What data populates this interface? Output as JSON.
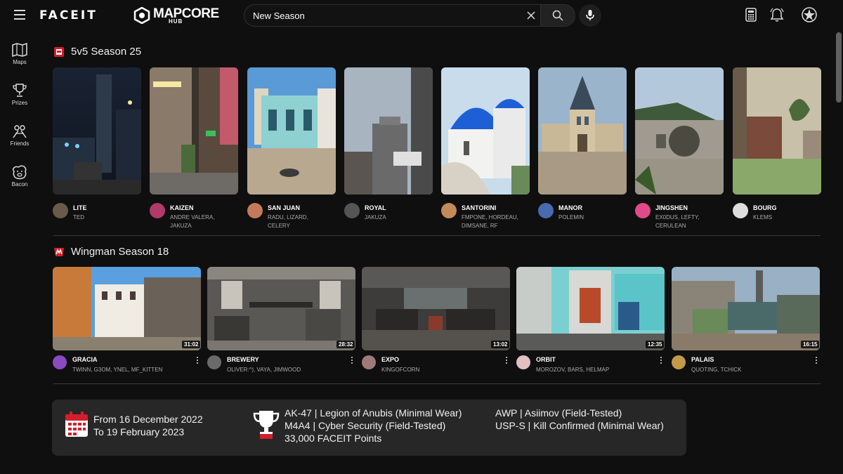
{
  "header": {
    "brand": "FACEIT",
    "partner_brand": "MAPCORE",
    "partner_sub": "HUB",
    "search_value": "New Season"
  },
  "sidebar": {
    "items": [
      {
        "label": "Maps",
        "icon": "map-icon"
      },
      {
        "label": "Prizes",
        "icon": "trophy-icon"
      },
      {
        "label": "Friends",
        "icon": "friends-icon"
      },
      {
        "label": "Bacon",
        "icon": "bacon-icon"
      }
    ]
  },
  "section1": {
    "title": "5v5 Season 25",
    "cards": [
      {
        "name": "LITE",
        "authors": [
          "TED"
        ],
        "avatar_color": "#6a5a4a"
      },
      {
        "name": "KAIZEN",
        "authors": [
          "ANDRE VALERA,",
          "JAKUZA"
        ],
        "avatar_color": "#b03a6a"
      },
      {
        "name": "SAN JUAN",
        "authors": [
          "RADU, LIZARD,",
          "CELERY"
        ],
        "avatar_color": "#c47a5a"
      },
      {
        "name": "ROYAL",
        "authors": [
          "JAKUZA"
        ],
        "avatar_color": "#555555"
      },
      {
        "name": "SANTORINI",
        "authors": [
          "FMPONE, HORDEAU,",
          "DIMSANE, RF"
        ],
        "avatar_color": "#c48a5a"
      },
      {
        "name": "MANOR",
        "authors": [
          "POLEMIN"
        ],
        "avatar_color": "#4a6ab0"
      },
      {
        "name": "JINGSHEN",
        "authors": [
          "EX0DUS, LEFTY,",
          "CERULEAN"
        ],
        "avatar_color": "#e04a8a"
      },
      {
        "name": "BOURG",
        "authors": [
          "KLEMS"
        ],
        "avatar_color": "#dddddd"
      }
    ]
  },
  "section2": {
    "title": "Wingman Season 18",
    "cards": [
      {
        "name": "GRACIA",
        "authors": "TWINN, G3OM, YNEL, MF_KITTEN",
        "duration": "31:02",
        "avatar_color": "#8a4ac4"
      },
      {
        "name": "BREWERY",
        "authors": "OLIVER:^), VAYA, JIMWOOD",
        "duration": "28:32",
        "avatar_color": "#6a6a6a"
      },
      {
        "name": "EXPO",
        "authors": "KINGOFCORN",
        "duration": "13:02",
        "avatar_color": "#a07a7a"
      },
      {
        "name": "ORBIT",
        "authors": "MOROZOV, BARS, HELMAP",
        "duration": "12:35",
        "avatar_color": "#e0c0c0"
      },
      {
        "name": "PALAIS",
        "authors": "QUOTING, TCHICK",
        "duration": "16:15",
        "avatar_color": "#c49a4a"
      }
    ]
  },
  "info": {
    "date_from": "From 16 December 2022",
    "date_to": "To 19 February 2023",
    "prize_1": "AK-47 | Legion of Anubis (Minimal Wear)",
    "prize_2": "M4A4 | Cyber Security (Field-Tested)",
    "prize_3": "33,000 FACEIT Points",
    "prize_4": "AWP | Asiimov (Field-Tested)",
    "prize_5": "USP-S | Kill Confirmed (Minimal Wear)"
  },
  "colors": {
    "background": "#0f0f0f",
    "panel": "#272727",
    "accent_red": "#d21f2b"
  }
}
